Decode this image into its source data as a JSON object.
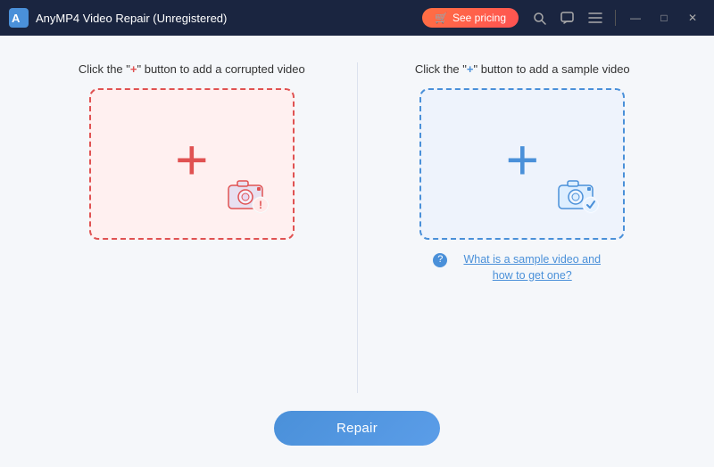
{
  "titlebar": {
    "logo_alt": "AnyMP4 logo",
    "title": "AnyMP4 Video Repair (Unregistered)",
    "pricing_label": "See pricing",
    "pricing_icon": "cart-icon",
    "controls": {
      "search": "🔍",
      "chat": "💬",
      "menu": "☰",
      "minimize": "—",
      "maximize": "□",
      "close": "✕"
    }
  },
  "left_panel": {
    "instruction_prefix": "Click the \"",
    "instruction_plus": "+",
    "instruction_suffix": "\" button to add a corrupted video",
    "drop_zone_aria": "Add corrupted video drop zone",
    "plus_symbol": "+"
  },
  "right_panel": {
    "instruction_prefix": "Click the \"",
    "instruction_plus": "+",
    "instruction_suffix": "\" button to add a sample video",
    "drop_zone_aria": "Add sample video drop zone",
    "plus_symbol": "+",
    "help_q": "?",
    "help_text": "What is a sample video and how to get one?"
  },
  "repair_button": {
    "label": "Repair"
  }
}
